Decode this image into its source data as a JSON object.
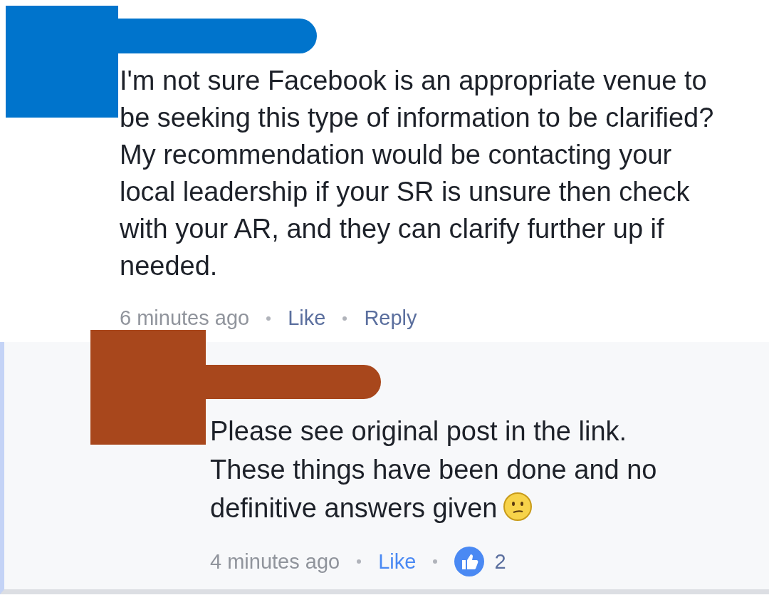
{
  "comments": [
    {
      "color": "#0074cc",
      "reply": false,
      "text": "I'm not sure Facebook is an appropriate venue to be seeking this type of information to be clarified? My recommendation would be contacting your local leadership if your SR is unsure then check with your AR, and they can clarify further up if needed.",
      "emoji": false,
      "meta": [
        {
          "kind": "time",
          "text": "6 minutes ago"
        },
        {
          "kind": "link",
          "text": "Like",
          "active": false
        },
        {
          "kind": "link",
          "text": "Reply",
          "active": false
        }
      ]
    },
    {
      "color": "#a8471c",
      "reply": true,
      "text": "Please see original post in the link. These things have been done and no definitive answers given",
      "emoji": true,
      "meta": [
        {
          "kind": "time",
          "text": "4 minutes ago"
        },
        {
          "kind": "link",
          "text": "Like",
          "active": true
        },
        {
          "kind": "reaction",
          "text": "2"
        }
      ]
    }
  ]
}
